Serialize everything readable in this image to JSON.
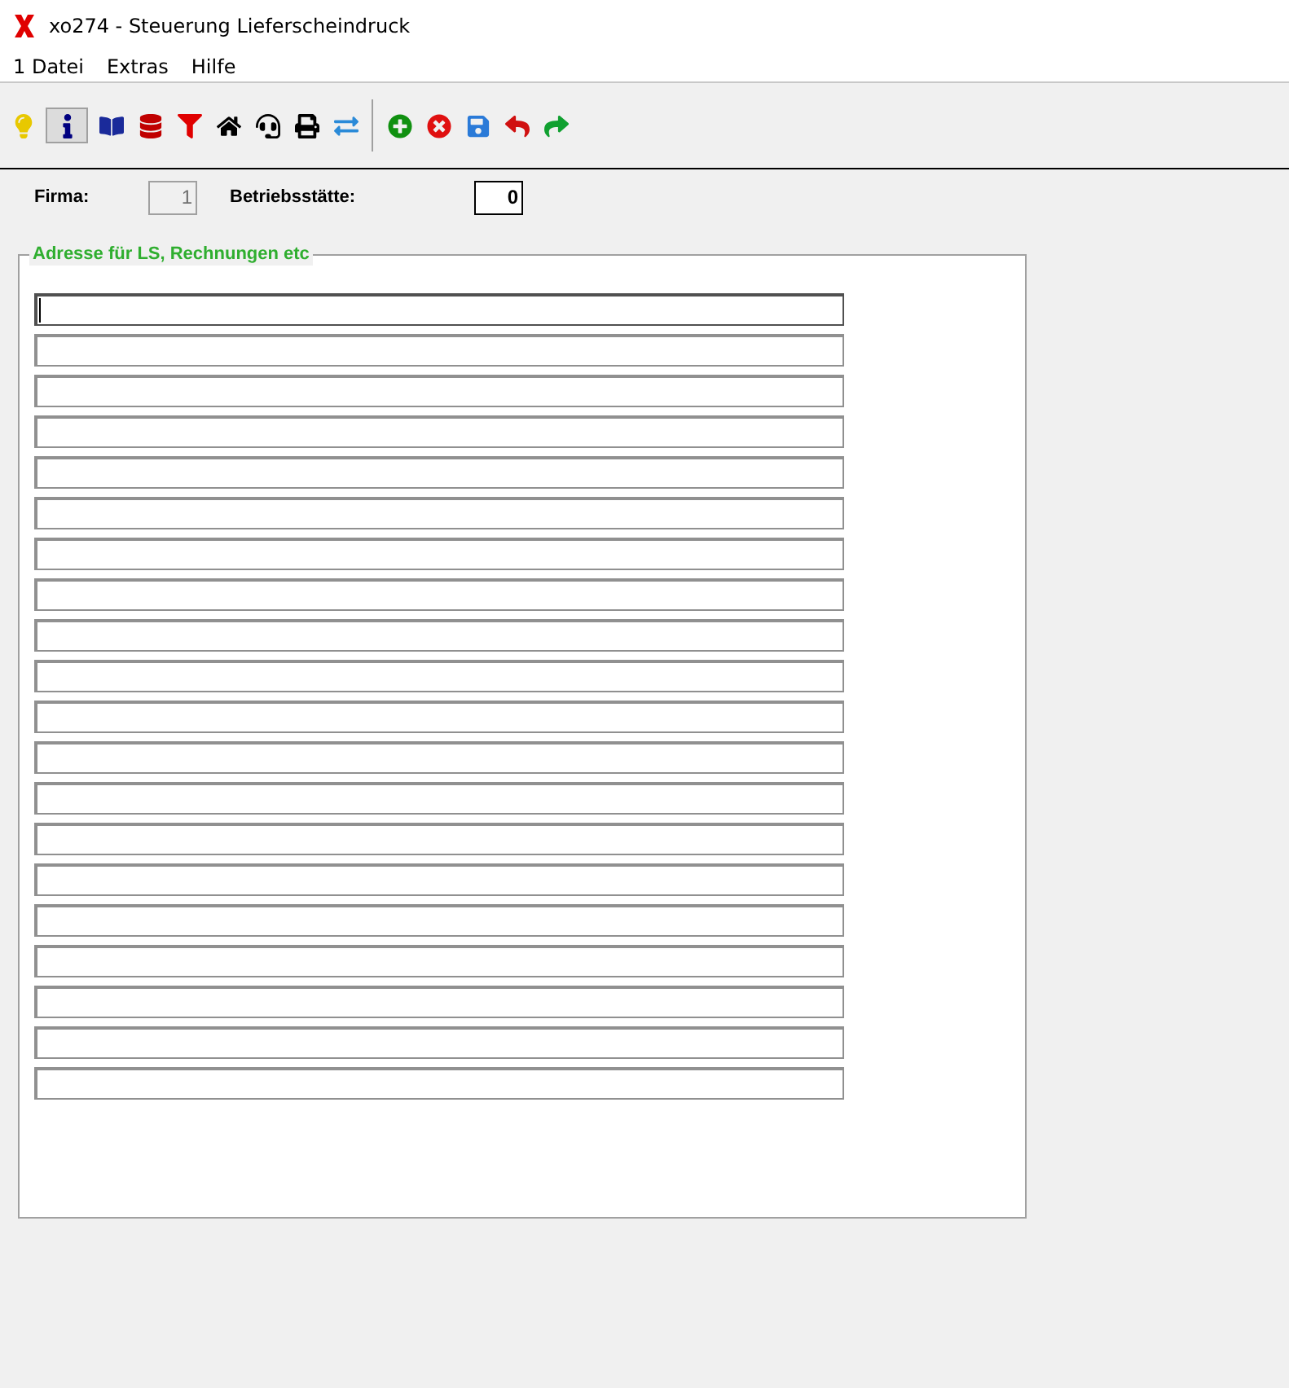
{
  "window": {
    "title": "xo274 - Steuerung Lieferscheindruck"
  },
  "menu": [
    "1 Datei",
    "Extras",
    "Hilfe"
  ],
  "toolbar": [
    {
      "kind": "bulb"
    },
    {
      "kind": "info",
      "pressed": true
    },
    {
      "kind": "book"
    },
    {
      "kind": "database"
    },
    {
      "kind": "filter"
    },
    {
      "kind": "home"
    },
    {
      "kind": "headset"
    },
    {
      "kind": "printer"
    },
    {
      "kind": "remote"
    },
    {
      "kind": "separator"
    },
    {
      "kind": "add"
    },
    {
      "kind": "delete"
    },
    {
      "kind": "save"
    },
    {
      "kind": "undo"
    },
    {
      "kind": "redo"
    }
  ],
  "firma": {
    "label": "Firma:",
    "value": "1",
    "disabled": true
  },
  "betriebsstaette": {
    "label": "Betriebsstätte:",
    "value": "0",
    "disabled": false
  },
  "address_group": {
    "title": "Adresse für LS, Rechnungen etc",
    "lines": [
      {
        "focused": true
      },
      {
        "focused": false
      },
      {
        "focused": false
      },
      {
        "focused": false
      },
      {
        "focused": false
      },
      {
        "focused": false
      },
      {
        "focused": false
      },
      {
        "focused": false
      },
      {
        "focused": false
      },
      {
        "focused": false
      },
      {
        "focused": false
      },
      {
        "focused": false
      },
      {
        "focused": false
      },
      {
        "focused": false
      },
      {
        "focused": false
      },
      {
        "focused": false
      },
      {
        "focused": false
      },
      {
        "focused": false
      },
      {
        "focused": false
      },
      {
        "focused": false
      }
    ]
  }
}
